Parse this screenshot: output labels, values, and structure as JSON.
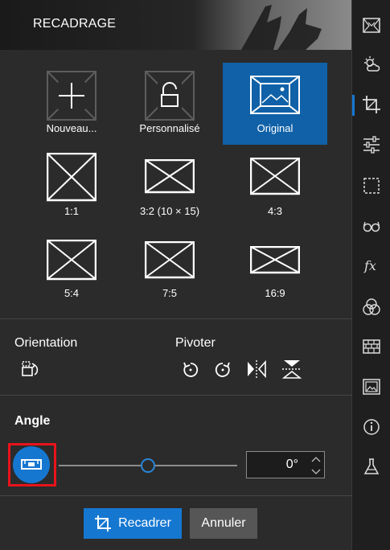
{
  "header": {
    "title": "RECADRAGE"
  },
  "ratios": [
    {
      "label": "Nouveau...",
      "icon": "plus-icon"
    },
    {
      "label": "Personnalisé",
      "icon": "unlock-icon"
    },
    {
      "label": "Original",
      "icon": "image-icon",
      "selected": true
    },
    {
      "label": "1:1",
      "icon": "ratio-frame-icon"
    },
    {
      "label": "3:2 (10 × 15)",
      "icon": "ratio-frame-icon"
    },
    {
      "label": "4:3",
      "icon": "ratio-frame-icon"
    },
    {
      "label": "5:4",
      "icon": "ratio-frame-icon"
    },
    {
      "label": "7:5",
      "icon": "ratio-frame-icon"
    },
    {
      "label": "16:9",
      "icon": "ratio-frame-icon"
    }
  ],
  "orientation": {
    "label": "Orientation"
  },
  "rotate": {
    "label": "Pivoter"
  },
  "angle": {
    "label": "Angle",
    "value": "0°",
    "slider_fraction": 0.5
  },
  "actions": {
    "crop": "Recadrer",
    "cancel": "Annuler"
  },
  "colors": {
    "accent": "#1677d1",
    "selected_tile": "#1061a8",
    "highlight": "#e8131b"
  },
  "rail_icons": [
    "image-frames-icon",
    "weather-icon",
    "crop-icon",
    "sliders-icon",
    "selection-icon",
    "glasses-icon",
    "fx-icon",
    "color-circles-icon",
    "texture-icon",
    "picture-icon",
    "info-icon",
    "flask-icon"
  ]
}
